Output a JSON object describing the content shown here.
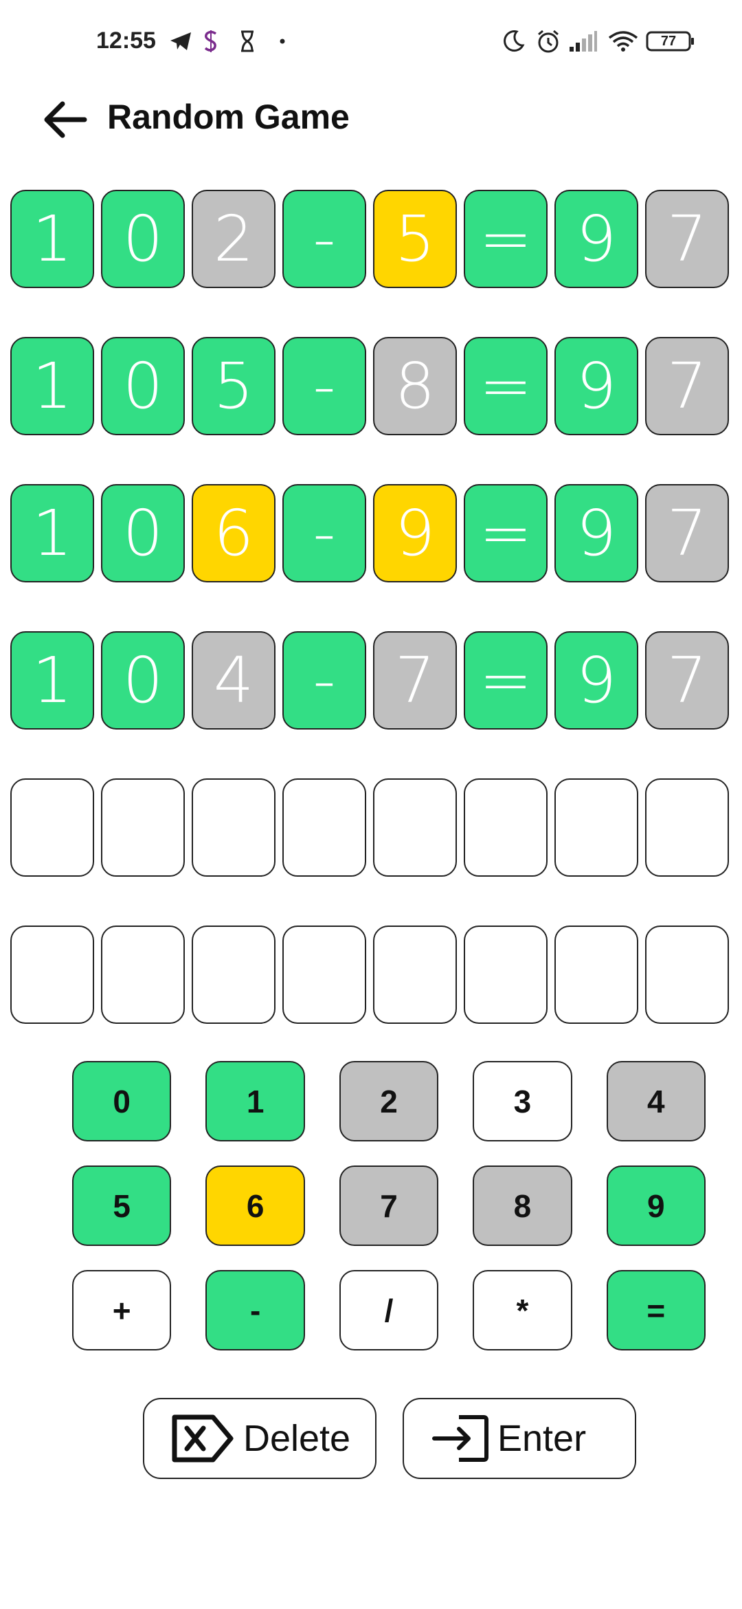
{
  "status_bar": {
    "time": "12:55",
    "battery": "77",
    "icons": [
      "telegram-icon",
      "s-app-icon",
      "hourglass-icon",
      "dot-icon",
      "moon-icon",
      "alarm-icon",
      "signal-icon",
      "wifi-icon",
      "battery-icon"
    ]
  },
  "app_bar": {
    "title": "Random Game",
    "back_icon": "arrow-left-icon"
  },
  "colors": {
    "green": "#33de85",
    "yellow": "#ffd600",
    "gray": "#c0c0c0",
    "empty": "#ffffff"
  },
  "board": {
    "rows": [
      [
        {
          "char": "1",
          "state": "green"
        },
        {
          "char": "0",
          "state": "green"
        },
        {
          "char": "2",
          "state": "gray"
        },
        {
          "char": "-",
          "state": "green"
        },
        {
          "char": "5",
          "state": "yellow"
        },
        {
          "char": "=",
          "state": "green"
        },
        {
          "char": "9",
          "state": "green"
        },
        {
          "char": "7",
          "state": "gray"
        }
      ],
      [
        {
          "char": "1",
          "state": "green"
        },
        {
          "char": "0",
          "state": "green"
        },
        {
          "char": "5",
          "state": "green"
        },
        {
          "char": "-",
          "state": "green"
        },
        {
          "char": "8",
          "state": "gray"
        },
        {
          "char": "=",
          "state": "green"
        },
        {
          "char": "9",
          "state": "green"
        },
        {
          "char": "7",
          "state": "gray"
        }
      ],
      [
        {
          "char": "1",
          "state": "green"
        },
        {
          "char": "0",
          "state": "green"
        },
        {
          "char": "6",
          "state": "yellow"
        },
        {
          "char": "-",
          "state": "green"
        },
        {
          "char": "9",
          "state": "yellow"
        },
        {
          "char": "=",
          "state": "green"
        },
        {
          "char": "9",
          "state": "green"
        },
        {
          "char": "7",
          "state": "gray"
        }
      ],
      [
        {
          "char": "1",
          "state": "green"
        },
        {
          "char": "0",
          "state": "green"
        },
        {
          "char": "4",
          "state": "gray"
        },
        {
          "char": "-",
          "state": "green"
        },
        {
          "char": "7",
          "state": "gray"
        },
        {
          "char": "=",
          "state": "green"
        },
        {
          "char": "9",
          "state": "green"
        },
        {
          "char": "7",
          "state": "gray"
        }
      ],
      [
        {
          "char": "",
          "state": "empty"
        },
        {
          "char": "",
          "state": "empty"
        },
        {
          "char": "",
          "state": "empty"
        },
        {
          "char": "",
          "state": "empty"
        },
        {
          "char": "",
          "state": "empty"
        },
        {
          "char": "",
          "state": "empty"
        },
        {
          "char": "",
          "state": "empty"
        },
        {
          "char": "",
          "state": "empty"
        }
      ],
      [
        {
          "char": "",
          "state": "empty"
        },
        {
          "char": "",
          "state": "empty"
        },
        {
          "char": "",
          "state": "empty"
        },
        {
          "char": "",
          "state": "empty"
        },
        {
          "char": "",
          "state": "empty"
        },
        {
          "char": "",
          "state": "empty"
        },
        {
          "char": "",
          "state": "empty"
        },
        {
          "char": "",
          "state": "empty"
        }
      ]
    ]
  },
  "keyboard": {
    "rows": [
      [
        {
          "label": "0",
          "state": "green"
        },
        {
          "label": "1",
          "state": "green"
        },
        {
          "label": "2",
          "state": "gray"
        },
        {
          "label": "3",
          "state": "empty"
        },
        {
          "label": "4",
          "state": "gray"
        }
      ],
      [
        {
          "label": "5",
          "state": "green"
        },
        {
          "label": "6",
          "state": "yellow"
        },
        {
          "label": "7",
          "state": "gray"
        },
        {
          "label": "8",
          "state": "gray"
        },
        {
          "label": "9",
          "state": "green"
        }
      ],
      [
        {
          "label": "+",
          "state": "empty"
        },
        {
          "label": "-",
          "state": "green"
        },
        {
          "label": "/",
          "state": "empty"
        },
        {
          "label": "*",
          "state": "empty"
        },
        {
          "label": "=",
          "state": "green"
        }
      ]
    ]
  },
  "actions": {
    "delete_label": "Delete",
    "delete_icon": "backspace-icon",
    "enter_label": "Enter",
    "enter_icon": "enter-icon"
  }
}
